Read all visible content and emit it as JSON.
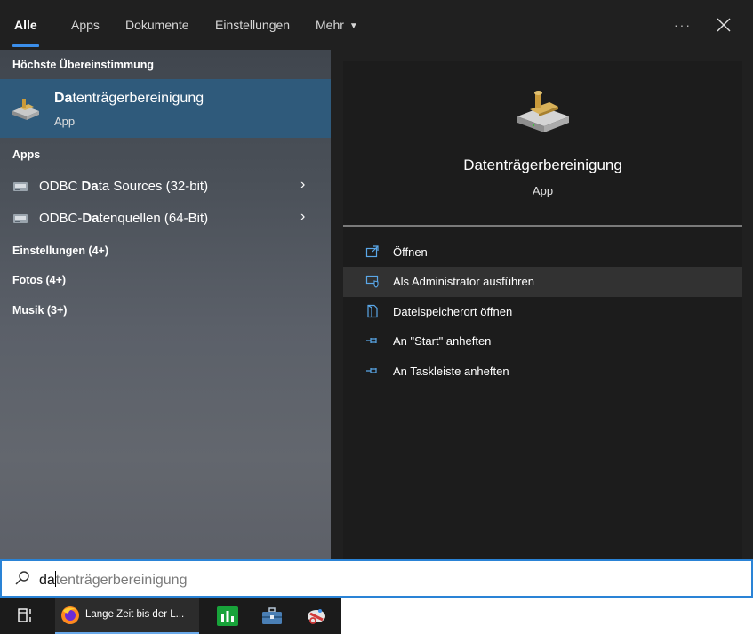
{
  "tabs": {
    "items": [
      "Alle",
      "Apps",
      "Dokumente",
      "Einstellungen"
    ],
    "more_label": "Mehr",
    "active": "Alle",
    "dots": "···"
  },
  "left": {
    "best_match_header": "Höchste Übereinstimmung",
    "best_match": {
      "title_bold": "Da",
      "title_rest": "tenträgerbereinigung",
      "subtitle": "App"
    },
    "apps_header": "Apps",
    "apps": [
      {
        "pre": "ODBC ",
        "bold": "Da",
        "post": "ta Sources (32-bit)",
        "chevron": "›"
      },
      {
        "pre": "ODBC-",
        "bold": "Da",
        "post": "tenquellen (64-Bit)",
        "chevron": "›"
      }
    ],
    "categories": [
      "Einstellungen (4+)",
      "Fotos (4+)",
      "Musik (3+)"
    ]
  },
  "preview": {
    "title": "Datenträgerbereinigung",
    "subtitle": "App",
    "actions": [
      {
        "label": "Öffnen",
        "icon": "open-icon"
      },
      {
        "label": "Als Administrator ausführen",
        "icon": "admin-shield-icon"
      },
      {
        "label": "Dateispeicherort öffnen",
        "icon": "file-location-icon"
      },
      {
        "label": "An \"Start\" anheften",
        "icon": "pin-icon"
      },
      {
        "label": "An Taskleiste anheften",
        "icon": "pin-icon"
      }
    ]
  },
  "search": {
    "typed": "da",
    "suggestion": "tenträgerbereinigung"
  },
  "taskbar": {
    "firefox_label": "Lange Zeit bis der L..."
  },
  "colors": {
    "accent": "#3b8eea",
    "selected_row": "#2f5a7b",
    "panel_bg": "#202020"
  }
}
